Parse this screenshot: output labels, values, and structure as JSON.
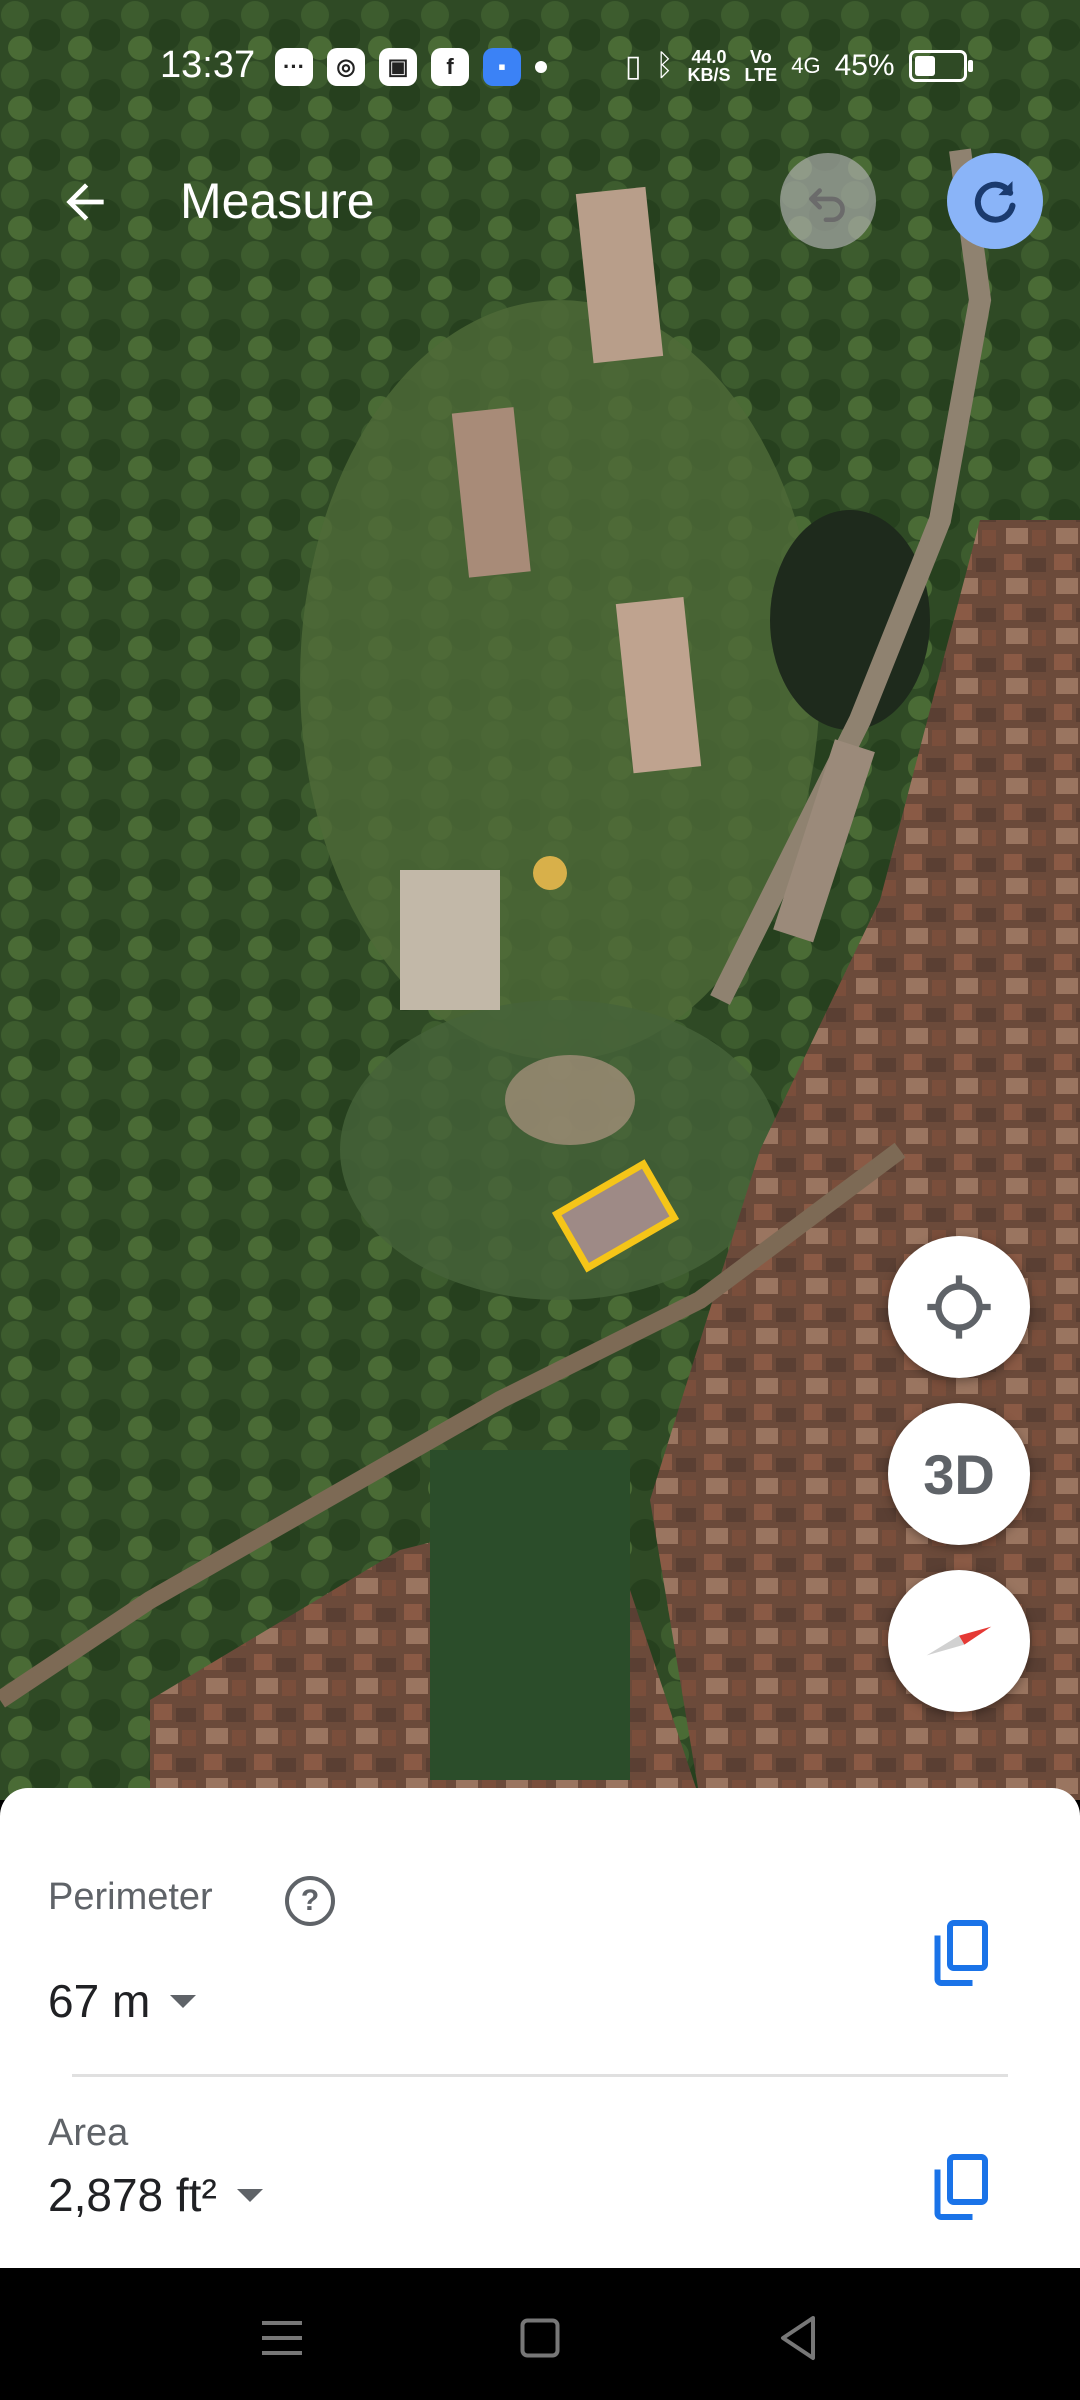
{
  "status_bar": {
    "time": "13:37",
    "apps": [
      "messages-icon",
      "instagram-icon",
      "app-icon",
      "facebook-icon",
      "app-icon",
      "dot"
    ],
    "network_speed_value": "44.0",
    "network_speed_unit": "KB/S",
    "volte_top": "Vo",
    "volte_bottom": "LTE",
    "signal": "4G",
    "battery": "45%"
  },
  "header": {
    "title": "Measure",
    "back_icon": "arrow-back-icon",
    "undo_icon": "undo-icon",
    "redo_icon": "redo-icon"
  },
  "map_controls": {
    "locate_icon": "my-location-icon",
    "threed_label": "3D",
    "compass_icon": "compass-icon"
  },
  "measurement": {
    "perimeter_label": "Perimeter",
    "perimeter_value": "67 m",
    "help_icon": "?",
    "area_label": "Area",
    "area_value": "2,878 ft²"
  },
  "colors": {
    "accent_blue": "#1a73e8",
    "redo_button": "#8ab4f8",
    "measure_outline": "#f5c518"
  }
}
